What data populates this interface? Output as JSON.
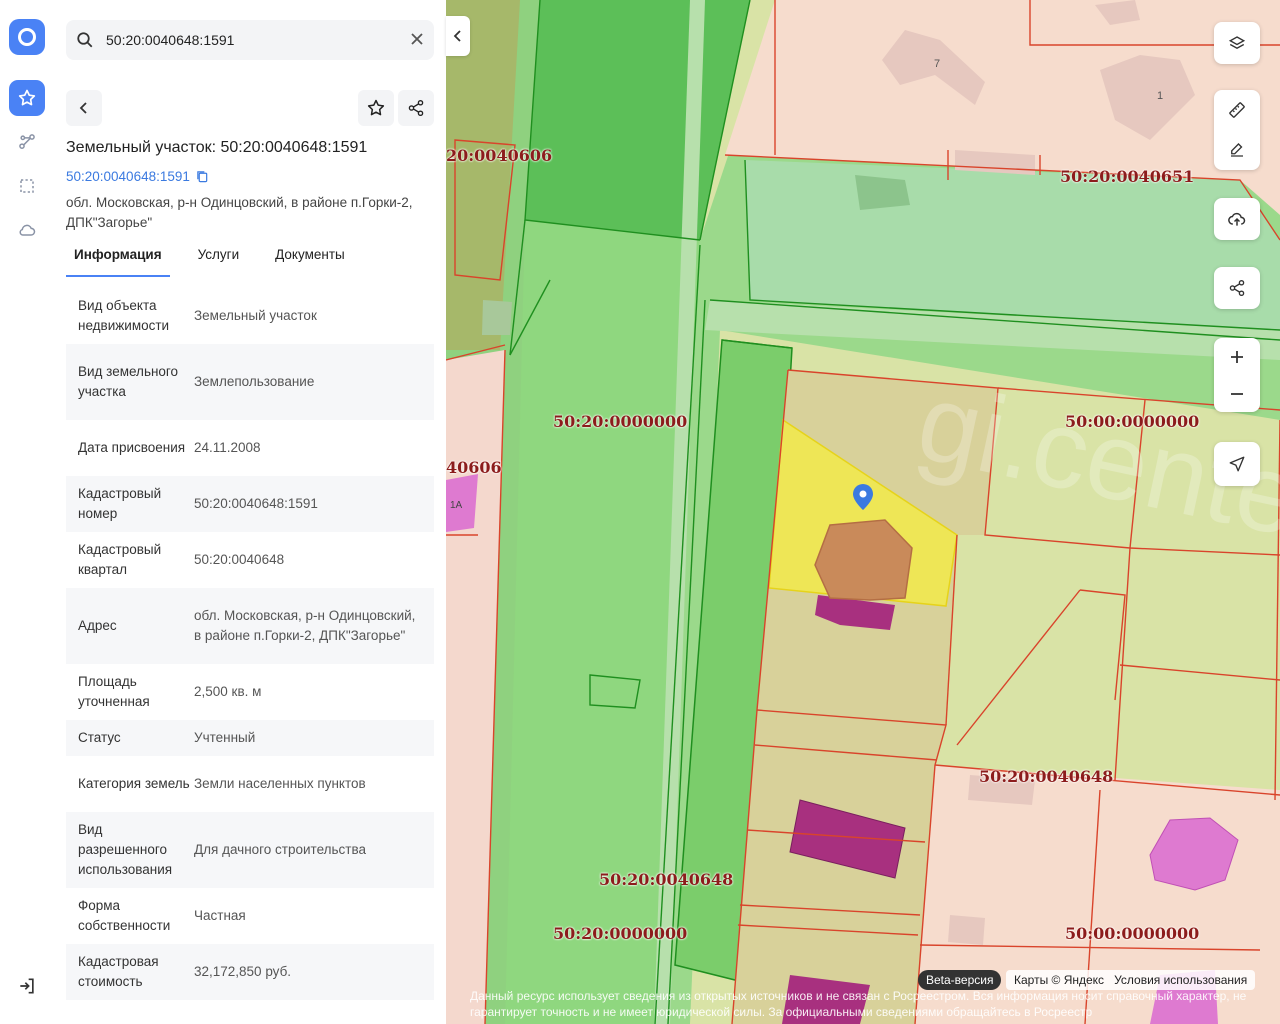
{
  "search": {
    "value": "50:20:0040648:1591"
  },
  "object": {
    "title": "Земельный участок: 50:20:0040648:1591",
    "cadastral_link": "50:20:0040648:1591",
    "address_line": "обл. Московская, р-н Одинцовский, в районе п.Горки-2, ДПК\"Загорье\""
  },
  "tabs": [
    {
      "label": "Информация",
      "active": true
    },
    {
      "label": "Услуги",
      "active": false
    },
    {
      "label": "Документы",
      "active": false
    }
  ],
  "info_rows": [
    {
      "key": "Вид объекта недвижимости",
      "value": "Земельный участок"
    },
    {
      "key": "Вид земельного участка",
      "value": "Землепользование"
    },
    {
      "key": "Дата присвоения",
      "value": "24.11.2008"
    },
    {
      "key": "Кадастровый номер",
      "value": "50:20:0040648:1591"
    },
    {
      "key": "Кадастровый квартал",
      "value": "50:20:0040648"
    },
    {
      "key": "Адрес",
      "value": "обл. Московская, р-н Одинцовский, в районе п.Горки-2, ДПК\"Загорье\""
    },
    {
      "key": "Площадь уточненная",
      "value": "2,500 кв. м"
    },
    {
      "key": "Статус",
      "value": "Учтенный"
    },
    {
      "key": "Категория земель",
      "value": "Земли населенных пунктов"
    },
    {
      "key": "Вид разрешенного использования",
      "value": "Для дачного строительства"
    },
    {
      "key": "Форма собственности",
      "value": "Частная"
    },
    {
      "key": "Кадастровая стоимость",
      "value": "32,172,850 руб."
    }
  ],
  "map": {
    "labels": [
      "20:0040606",
      "50:20:0040651",
      "50:20:0000000",
      "50:00:0000000",
      "40606",
      "50:20:0040648",
      "50:20:0040648",
      "50:20:0000000",
      "50:00:0000000"
    ],
    "house_numbers": [
      "7",
      "1",
      "1А"
    ],
    "watermark": "gi.center",
    "beta": "Beta-версия",
    "attribution_maps": "Карты © Яндекс",
    "attribution_terms": "Условия использования",
    "disclaimer": "Данный ресурс использует сведения из открытых источников и не связан с Росреестром. Вся информация носит справочный характер, не гарантирует точность и не имеет юридической силы. За официальными сведениями обращайтесь в Росреестр"
  },
  "colors": {
    "accent": "#4a82f5",
    "selected_parcel": "#f2ea4a",
    "cad_border": "#d9442b",
    "label": "#8c1c1c"
  }
}
